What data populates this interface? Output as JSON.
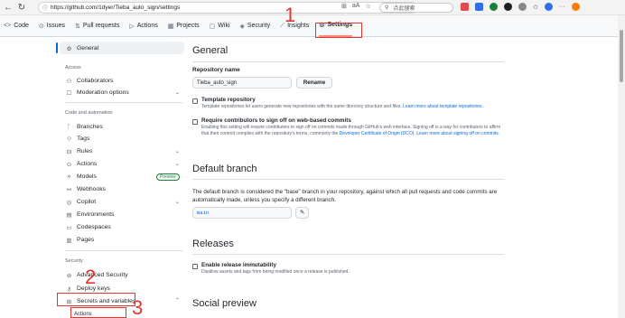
{
  "browser": {
    "url": "https://github.com/1dyer/Tieba_auto_sign/settings",
    "search_text": "点此搜索",
    "aa_label": "aA",
    "colors": {
      "ext1": "#e5484d",
      "ext2": "#2f6fed",
      "ext3": "#1a7f37",
      "ext4": "#202020",
      "ext5": "#ff7a00"
    }
  },
  "repo_nav": {
    "tabs": [
      {
        "label": "Code",
        "icon": "<>"
      },
      {
        "label": "Issues",
        "icon": "⊙"
      },
      {
        "label": "Pull requests",
        "icon": "⇅"
      },
      {
        "label": "Actions",
        "icon": "▷"
      },
      {
        "label": "Projects",
        "icon": "▦"
      },
      {
        "label": "Wiki",
        "icon": "▢"
      },
      {
        "label": "Security",
        "icon": "◈"
      },
      {
        "label": "Insights",
        "icon": "⟋"
      },
      {
        "label": "Settings",
        "icon": "⚙"
      }
    ]
  },
  "annotations": {
    "n1": "1",
    "n2": "2",
    "n3": "3",
    "color": "#e3342f"
  },
  "sidebar": {
    "general": "General",
    "access_head": "Access",
    "collaborators": "Collaborators",
    "moderation": "Moderation options",
    "code_head": "Code and automation",
    "branches": "Branches",
    "tags": "Tags",
    "rules": "Rules",
    "actions": "Actions",
    "models": "Models",
    "models_badge": "Preview",
    "webhooks": "Webhooks",
    "copilot": "Copilot",
    "environments": "Environments",
    "codespaces": "Codespaces",
    "pages": "Pages",
    "security_head": "Security",
    "advanced_security": "Advanced Security",
    "deploy_keys": "Deploy keys",
    "secrets": "Secrets and variables",
    "secrets_actions": "Actions"
  },
  "main": {
    "general_title": "General",
    "repo_name_label": "Repository name",
    "repo_name_value": "Tieba_auto_sign",
    "rename_button": "Rename",
    "template_title": "Template repository",
    "template_desc": "Template repositories let users generate new repositories with the same directory structure and files. ",
    "template_link": "Learn more about template repositories.",
    "signoff_title": "Require contributors to sign off on web-based commits",
    "signoff_desc": "Enabling this setting will require contributors to sign off on commits made through GitHub's web interface. Signing off is a way for contributors to affirm that their commit complies with the repository's terms, commonly the ",
    "signoff_link1": "Developer Certificate of Origin (DCO)",
    "signoff_mid": ". ",
    "signoff_link2": "Learn more about signing off on commits.",
    "default_branch_title": "Default branch",
    "default_branch_desc": "The default branch is considered the \"base\" branch in your repository, against which all pull requests and code commits are automatically made, unless you specify a different branch.",
    "branch_value": "main",
    "releases_title": "Releases",
    "immutability_title": "Enable release immutability",
    "immutability_desc": "Disallow assets and tags from being modified once a release is published.",
    "social_title": "Social preview"
  }
}
